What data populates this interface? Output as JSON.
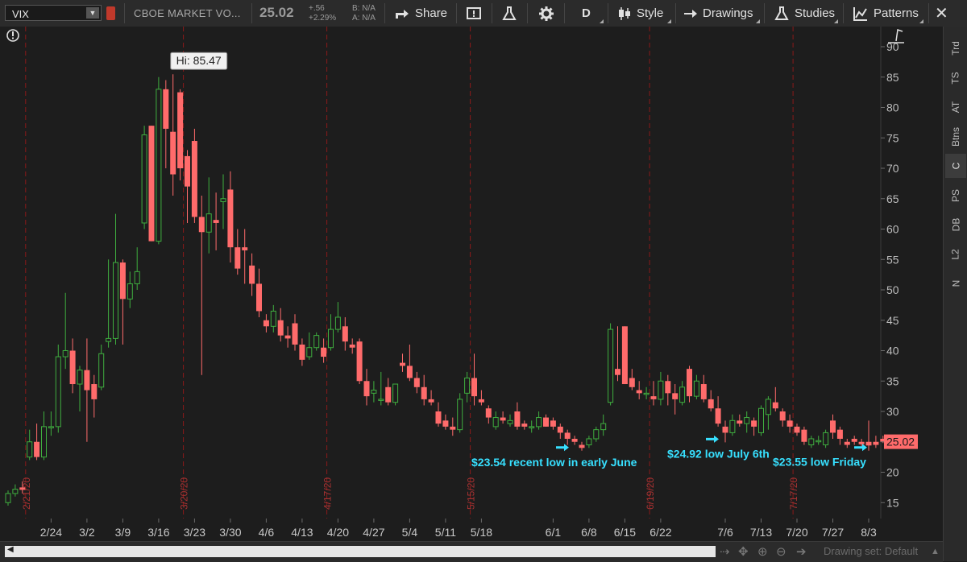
{
  "toolbar": {
    "symbol": "VIX",
    "description": "CBOE MARKET VO...",
    "last_price": "25.02",
    "net_change": "+.56",
    "pct_change": "+2.29%",
    "bid": "B: N/A",
    "ask": "A: N/A",
    "share_label": "Share",
    "aggregation": "D",
    "style_label": "Style",
    "drawings_label": "Drawings",
    "studies_label": "Studies",
    "patterns_label": "Patterns"
  },
  "side_tabs": [
    "Trd",
    "TS",
    "AT",
    "Btns",
    "C",
    "PS",
    "DB",
    "L2",
    "N"
  ],
  "active_side_tab": "C",
  "bottom": {
    "drawing_set": "Drawing set: Default"
  },
  "colors": {
    "up": "#3fae3f",
    "down": "#ff6b6b",
    "annotation": "#37e0ff",
    "bg": "#1d1d1d",
    "period_line": "#8b1a1a"
  },
  "chart_data": {
    "type": "candlestick",
    "symbol": "VIX",
    "ylim": [
      13,
      92
    ],
    "y_ticks": [
      15,
      20,
      25,
      30,
      35,
      40,
      45,
      50,
      55,
      60,
      65,
      70,
      75,
      80,
      85,
      90
    ],
    "x_ticks": [
      {
        "label": "2/24",
        "i": 6
      },
      {
        "label": "3/2",
        "i": 11
      },
      {
        "label": "3/9",
        "i": 16
      },
      {
        "label": "3/16",
        "i": 21
      },
      {
        "label": "3/23",
        "i": 26
      },
      {
        "label": "3/30",
        "i": 31
      },
      {
        "label": "4/6",
        "i": 36
      },
      {
        "label": "4/13",
        "i": 41
      },
      {
        "label": "4/20",
        "i": 46
      },
      {
        "label": "4/27",
        "i": 51
      },
      {
        "label": "5/4",
        "i": 56
      },
      {
        "label": "5/11",
        "i": 61
      },
      {
        "label": "5/18",
        "i": 66
      },
      {
        "label": "6/1",
        "i": 76
      },
      {
        "label": "6/8",
        "i": 81
      },
      {
        "label": "6/15",
        "i": 86
      },
      {
        "label": "6/22",
        "i": 91
      },
      {
        "label": "7/6",
        "i": 100
      },
      {
        "label": "7/13",
        "i": 105
      },
      {
        "label": "7/20",
        "i": 110
      },
      {
        "label": "7/27",
        "i": 115
      },
      {
        "label": "8/3",
        "i": 120
      }
    ],
    "period_lines": [
      {
        "label": "2/21/20",
        "i": 2
      },
      {
        "label": "3/20/20",
        "i": 24
      },
      {
        "label": "4/17/20",
        "i": 44
      },
      {
        "label": "5/15/20",
        "i": 64
      },
      {
        "label": "6/19/20",
        "i": 89
      },
      {
        "label": "7/17/20",
        "i": 109
      }
    ],
    "candles": [
      [
        15.0,
        17.0,
        14.5,
        16.5
      ],
      [
        16.5,
        18.0,
        16.0,
        17.2
      ],
      [
        17.5,
        18.5,
        16.5,
        17.1
      ],
      [
        22.5,
        27.0,
        22.0,
        25.0
      ],
      [
        25.0,
        28.0,
        22.0,
        22.5
      ],
      [
        22.5,
        30.0,
        22.0,
        27.5
      ],
      [
        27.5,
        30.0,
        26.0,
        27.5
      ],
      [
        27.5,
        41.0,
        26.5,
        39.0
      ],
      [
        39.0,
        49.5,
        37.0,
        40.0
      ],
      [
        40.0,
        42.0,
        33.0,
        34.5
      ],
      [
        34.5,
        37.5,
        30.0,
        36.8
      ],
      [
        36.8,
        42.0,
        25.0,
        33.5
      ],
      [
        34.5,
        36.0,
        29.0,
        32.0
      ],
      [
        34.0,
        41.0,
        33.5,
        39.5
      ],
      [
        41.5,
        55.0,
        40.5,
        42.0
      ],
      [
        42.0,
        62.5,
        41.0,
        54.5
      ],
      [
        54.5,
        55.0,
        41.0,
        48.5
      ],
      [
        48.5,
        53.0,
        47.0,
        51.0
      ],
      [
        51.0,
        57.0,
        50.0,
        53.0
      ],
      [
        61.0,
        77.0,
        60.0,
        75.5
      ],
      [
        77.0,
        77.0,
        58.0,
        58.0
      ],
      [
        58.0,
        85.0,
        57.5,
        83.0
      ],
      [
        83.0,
        84.5,
        70.0,
        76.5
      ],
      [
        76.0,
        85.47,
        65.5,
        69.0
      ],
      [
        82.5,
        83.0,
        68.0,
        70.0
      ],
      [
        72.0,
        73.0,
        61.0,
        67.0
      ],
      [
        74.5,
        76.5,
        61.0,
        62.0
      ],
      [
        62.0,
        65.5,
        36.0,
        59.5
      ],
      [
        59.5,
        68.5,
        56.0,
        62.5
      ],
      [
        61.5,
        66.0,
        56.5,
        61.0
      ],
      [
        64.5,
        69.0,
        60.0,
        65.0
      ],
      [
        66.5,
        69.5,
        54.5,
        57.0
      ],
      [
        57.0,
        60.0,
        52.5,
        53.5
      ],
      [
        57.0,
        60.0,
        51.0,
        56.5
      ],
      [
        54.0,
        56.0,
        49.0,
        51.0
      ],
      [
        51.0,
        53.5,
        45.5,
        46.5
      ],
      [
        45.0,
        46.0,
        43.0,
        44.0
      ],
      [
        44.0,
        47.5,
        43.0,
        46.5
      ],
      [
        45.0,
        47.0,
        41.5,
        42.5
      ],
      [
        42.5,
        44.0,
        40.5,
        42.0
      ],
      [
        44.5,
        46.0,
        40.0,
        41.0
      ],
      [
        41.0,
        42.0,
        37.5,
        38.5
      ],
      [
        39.0,
        43.0,
        38.5,
        40.5
      ],
      [
        40.5,
        43.0,
        40.0,
        42.5
      ],
      [
        40.5,
        42.0,
        38.0,
        39.0
      ],
      [
        40.5,
        46.0,
        40.0,
        43.5
      ],
      [
        43.5,
        48.0,
        43.0,
        45.5
      ],
      [
        44.0,
        45.5,
        40.0,
        41.5
      ],
      [
        41.0,
        42.0,
        39.5,
        40.5
      ],
      [
        41.5,
        42.0,
        34.5,
        35.0
      ],
      [
        35.0,
        37.0,
        31.0,
        32.5
      ],
      [
        33.0,
        35.0,
        31.5,
        33.5
      ],
      [
        32.0,
        36.5,
        31.0,
        32.0
      ],
      [
        34.0,
        35.5,
        31.0,
        31.5
      ],
      [
        31.5,
        34.5,
        31.0,
        34.5
      ],
      [
        38.0,
        39.5,
        36.5,
        37.5
      ],
      [
        37.5,
        41.0,
        35.0,
        35.5
      ],
      [
        35.5,
        36.5,
        33.0,
        34.0
      ],
      [
        34.0,
        36.0,
        31.0,
        32.0
      ],
      [
        32.0,
        33.5,
        31.0,
        31.5
      ],
      [
        30.0,
        31.5,
        27.5,
        28.0
      ],
      [
        28.5,
        29.5,
        27.0,
        27.5
      ],
      [
        27.5,
        29.0,
        26.0,
        27.0
      ],
      [
        27.0,
        33.0,
        26.5,
        32.0
      ],
      [
        33.0,
        36.5,
        31.5,
        35.5
      ],
      [
        35.5,
        39.5,
        31.0,
        32.5
      ],
      [
        32.0,
        33.5,
        31.0,
        31.5
      ],
      [
        30.5,
        31.0,
        28.0,
        29.0
      ],
      [
        27.5,
        30.0,
        27.0,
        29.0
      ],
      [
        29.0,
        30.0,
        28.0,
        28.5
      ],
      [
        28.0,
        29.5,
        27.5,
        28.5
      ],
      [
        30.0,
        31.5,
        27.0,
        27.5
      ],
      [
        28.0,
        28.5,
        27.0,
        27.5
      ],
      [
        27.5,
        28.5,
        26.5,
        27.5
      ],
      [
        27.5,
        30.0,
        27.0,
        29.0
      ],
      [
        29.0,
        29.5,
        27.5,
        27.5
      ],
      [
        28.5,
        29.0,
        27.0,
        27.5
      ],
      [
        27.5,
        28.0,
        25.5,
        26.5
      ],
      [
        26.5,
        27.0,
        24.5,
        25.5
      ],
      [
        25.5,
        26.0,
        24.5,
        25.0
      ],
      [
        24.5,
        25.0,
        23.54,
        24.0
      ],
      [
        24.5,
        26.0,
        24.0,
        25.5
      ],
      [
        25.5,
        27.5,
        25.0,
        27.0
      ],
      [
        27.0,
        29.5,
        26.0,
        28.0
      ],
      [
        31.5,
        44.5,
        31.0,
        43.5
      ],
      [
        37.0,
        44.0,
        35.0,
        36.0
      ],
      [
        44.0,
        44.0,
        34.5,
        34.5
      ],
      [
        35.5,
        37.0,
        33.5,
        34.0
      ],
      [
        33.5,
        35.0,
        32.0,
        33.0
      ],
      [
        33.0,
        34.0,
        32.0,
        33.0
      ],
      [
        32.5,
        35.0,
        31.0,
        32.0
      ],
      [
        32.0,
        36.5,
        31.0,
        35.0
      ],
      [
        35.0,
        36.0,
        31.0,
        33.0
      ],
      [
        33.0,
        34.5,
        29.5,
        32.0
      ],
      [
        31.5,
        35.0,
        31.0,
        34.0
      ],
      [
        37.0,
        37.5,
        31.5,
        32.5
      ],
      [
        32.5,
        36.0,
        32.0,
        35.0
      ],
      [
        34.5,
        36.0,
        31.5,
        32.0
      ],
      [
        32.0,
        33.5,
        30.0,
        30.5
      ],
      [
        30.5,
        32.5,
        27.5,
        28.0
      ],
      [
        27.5,
        28.5,
        24.92,
        26.5
      ],
      [
        26.5,
        29.5,
        26.0,
        28.5
      ],
      [
        28.5,
        29.5,
        27.5,
        28.0
      ],
      [
        28.0,
        30.0,
        26.5,
        29.0
      ],
      [
        28.5,
        29.0,
        26.0,
        27.5
      ],
      [
        26.5,
        31.0,
        26.0,
        30.5
      ],
      [
        29.5,
        32.5,
        27.0,
        32.0
      ],
      [
        31.5,
        34.0,
        30.0,
        30.5
      ],
      [
        30.0,
        30.5,
        27.5,
        28.5
      ],
      [
        28.5,
        29.5,
        26.5,
        27.5
      ],
      [
        27.5,
        28.0,
        26.0,
        26.5
      ],
      [
        27.0,
        27.5,
        24.5,
        25.0
      ],
      [
        24.5,
        26.0,
        24.0,
        25.5
      ],
      [
        25.0,
        26.0,
        24.5,
        25.2
      ],
      [
        24.5,
        27.0,
        24.0,
        26.5
      ],
      [
        28.5,
        29.5,
        25.5,
        26.5
      ],
      [
        27.0,
        27.5,
        24.5,
        25.5
      ],
      [
        25.0,
        25.5,
        24.0,
        24.5
      ],
      [
        25.5,
        26.0,
        24.5,
        25.0
      ],
      [
        25.0,
        25.5,
        24.0,
        24.6
      ],
      [
        25.0,
        28.5,
        23.55,
        24.4
      ],
      [
        25.0,
        26.0,
        24.0,
        24.5
      ],
      [
        25.5,
        26.0,
        24.8,
        25.02
      ]
    ],
    "hi_label": "Hi: 85.47",
    "annotations": [
      {
        "text": "$23.54 recent low in early June",
        "value": 23.54,
        "i": 80
      },
      {
        "text": "$24.92 low July 6th",
        "value": 24.92,
        "i": 100
      },
      {
        "text": "$23.55 low Friday",
        "value": 23.55,
        "i": 120
      }
    ],
    "last_price_label": "25.02"
  }
}
